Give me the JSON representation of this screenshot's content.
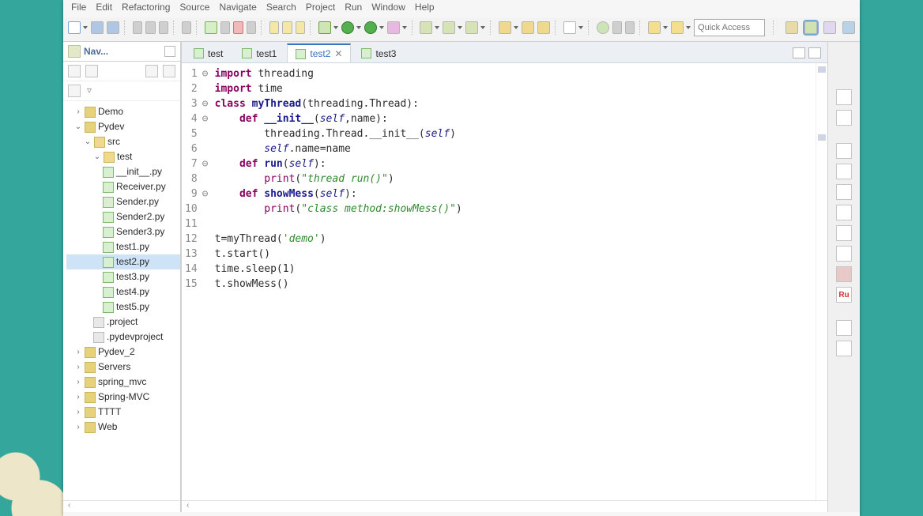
{
  "menu": [
    "File",
    "Edit",
    "Refactoring",
    "Source",
    "Navigate",
    "Search",
    "Project",
    "Run",
    "Window",
    "Help"
  ],
  "quick_access_placeholder": "Quick Access",
  "navigator": {
    "title": "Nav...",
    "projects": [
      "Demo",
      "Pydev",
      "Pydev_2",
      "Servers",
      "spring_mvc",
      "Spring-MVC",
      "TTTT",
      "Web"
    ],
    "expanded": {
      "Pydev": {
        "src": {
          "test": [
            "__init__.py",
            "Receiver.py",
            "Sender.py",
            "Sender2.py",
            "Sender3.py",
            "test1.py",
            "test2.py",
            "test3.py",
            "test4.py",
            "test5.py"
          ],
          "files": [
            ".project",
            ".pydevproject"
          ]
        }
      }
    },
    "selected_file": "test2.py"
  },
  "editor_tabs": [
    {
      "label": "test",
      "active": false
    },
    {
      "label": "test1",
      "active": false
    },
    {
      "label": "test2",
      "active": true
    },
    {
      "label": "test3",
      "active": false
    }
  ],
  "code": {
    "lines": [
      {
        "n": 1,
        "fold": "⊖",
        "tokens": [
          {
            "t": "import ",
            "c": "kw"
          },
          {
            "t": "threading",
            "c": ""
          }
        ]
      },
      {
        "n": 2,
        "fold": "",
        "tokens": [
          {
            "t": "import ",
            "c": "kw"
          },
          {
            "t": "time",
            "c": ""
          }
        ]
      },
      {
        "n": 3,
        "fold": "⊖",
        "tokens": [
          {
            "t": "class ",
            "c": "kw"
          },
          {
            "t": "myThread",
            "c": "def"
          },
          {
            "t": "(threading.Thread):",
            "c": ""
          }
        ]
      },
      {
        "n": 4,
        "fold": "⊖",
        "tokens": [
          {
            "t": "    ",
            "c": ""
          },
          {
            "t": "def ",
            "c": "kw"
          },
          {
            "t": "__init__",
            "c": "def"
          },
          {
            "t": "(",
            "c": ""
          },
          {
            "t": "self",
            "c": "self"
          },
          {
            "t": ",name):",
            "c": ""
          }
        ]
      },
      {
        "n": 5,
        "fold": "",
        "tokens": [
          {
            "t": "        threading.Thread.__init__(",
            "c": ""
          },
          {
            "t": "self",
            "c": "self"
          },
          {
            "t": ")",
            "c": ""
          }
        ]
      },
      {
        "n": 6,
        "fold": "",
        "tokens": [
          {
            "t": "        ",
            "c": ""
          },
          {
            "t": "self",
            "c": "self"
          },
          {
            "t": ".name=name",
            "c": ""
          }
        ]
      },
      {
        "n": 7,
        "fold": "⊖",
        "tokens": [
          {
            "t": "    ",
            "c": ""
          },
          {
            "t": "def ",
            "c": "kw"
          },
          {
            "t": "run",
            "c": "def"
          },
          {
            "t": "(",
            "c": ""
          },
          {
            "t": "self",
            "c": "self"
          },
          {
            "t": "):",
            "c": ""
          }
        ]
      },
      {
        "n": 8,
        "fold": "",
        "tokens": [
          {
            "t": "        ",
            "c": ""
          },
          {
            "t": "print",
            "c": "builtin"
          },
          {
            "t": "(",
            "c": ""
          },
          {
            "t": "\"thread run()\"",
            "c": "str"
          },
          {
            "t": ")",
            "c": ""
          }
        ]
      },
      {
        "n": 9,
        "fold": "⊖",
        "tokens": [
          {
            "t": "    ",
            "c": ""
          },
          {
            "t": "def ",
            "c": "kw"
          },
          {
            "t": "showMess",
            "c": "def"
          },
          {
            "t": "(",
            "c": ""
          },
          {
            "t": "self",
            "c": "self"
          },
          {
            "t": "):",
            "c": ""
          }
        ]
      },
      {
        "n": 10,
        "fold": "",
        "tokens": [
          {
            "t": "        ",
            "c": ""
          },
          {
            "t": "print",
            "c": "builtin"
          },
          {
            "t": "(",
            "c": ""
          },
          {
            "t": "\"class method:showMess()\"",
            "c": "str"
          },
          {
            "t": ")",
            "c": ""
          }
        ]
      },
      {
        "n": 11,
        "fold": "",
        "tokens": [
          {
            "t": "",
            "c": ""
          }
        ]
      },
      {
        "n": 12,
        "fold": "",
        "tokens": [
          {
            "t": "t=myThread(",
            "c": ""
          },
          {
            "t": "'demo'",
            "c": "str"
          },
          {
            "t": ")",
            "c": ""
          }
        ]
      },
      {
        "n": 13,
        "fold": "",
        "tokens": [
          {
            "t": "t.start()",
            "c": ""
          }
        ]
      },
      {
        "n": 14,
        "fold": "",
        "tokens": [
          {
            "t": "time.sleep(1)",
            "c": ""
          }
        ]
      },
      {
        "n": 15,
        "fold": "",
        "tokens": [
          {
            "t": "t.showMess()",
            "c": ""
          }
        ]
      }
    ]
  },
  "colors": {
    "keyword": "#8b0060",
    "def": "#1a1a8c",
    "string": "#2e8b2e"
  }
}
